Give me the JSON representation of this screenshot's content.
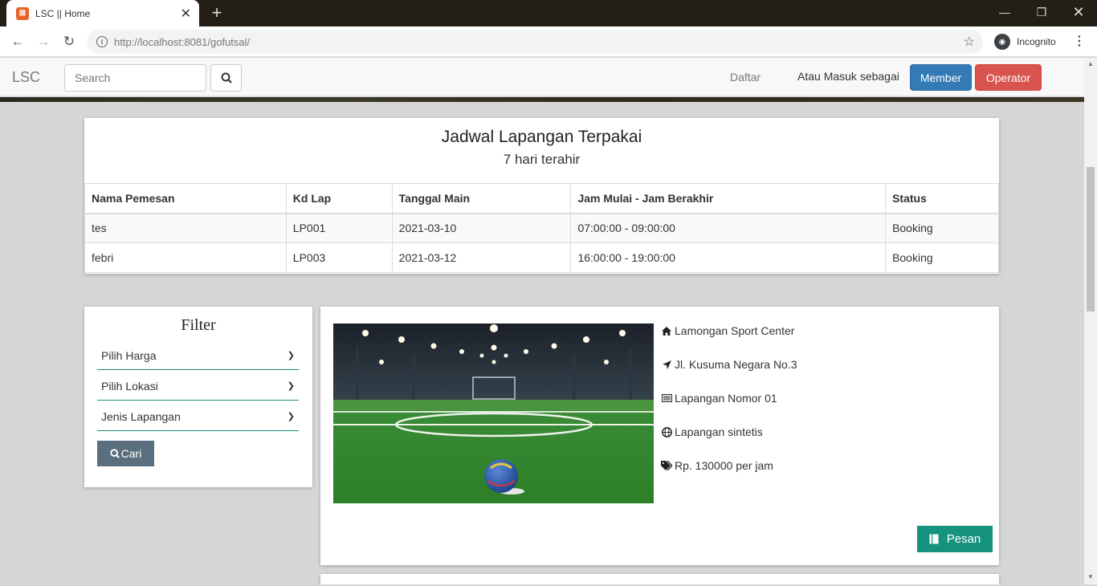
{
  "browser": {
    "tab_title": "LSC || Home",
    "url_host": "http://localhost",
    "url_rest": ":8081/gofutsal/",
    "profile_label": "Incognito"
  },
  "navbar": {
    "brand": "LSC",
    "search_placeholder": "Search",
    "daftar_label": "Daftar",
    "login_text": "Atau Masuk sebagai",
    "member_label": "Member",
    "operator_label": "Operator"
  },
  "schedule": {
    "title": "Jadwal Lapangan Terpakai",
    "subtitle": "7 hari terahir",
    "columns": [
      "Nama Pemesan",
      "Kd Lap",
      "Tanggal Main",
      "Jam Mulai - Jam Berakhir",
      "Status"
    ],
    "rows": [
      [
        "tes",
        "LP001",
        "2021-03-10",
        "07:00:00 - 09:00:00",
        "Booking"
      ],
      [
        "febri",
        "LP003",
        "2021-03-12",
        "16:00:00 - 19:00:00",
        "Booking"
      ]
    ]
  },
  "filter": {
    "title": "Filter",
    "harga": "Pilih Harga",
    "lokasi": "Pilih Lokasi",
    "jenis": "Jenis Lapangan",
    "button_label": "Cari"
  },
  "venue": {
    "name": "Lamongan Sport Center",
    "address": "Jl. Kusuma Negara No.3",
    "field_no": "Lapangan Nomor 01",
    "type": "Lapangan sintetis",
    "price": "Rp. 130000 per jam",
    "order_label": "Pesan"
  },
  "colors": {
    "member": "#337ab7",
    "operator": "#d9534f",
    "accent": "#16937f"
  }
}
